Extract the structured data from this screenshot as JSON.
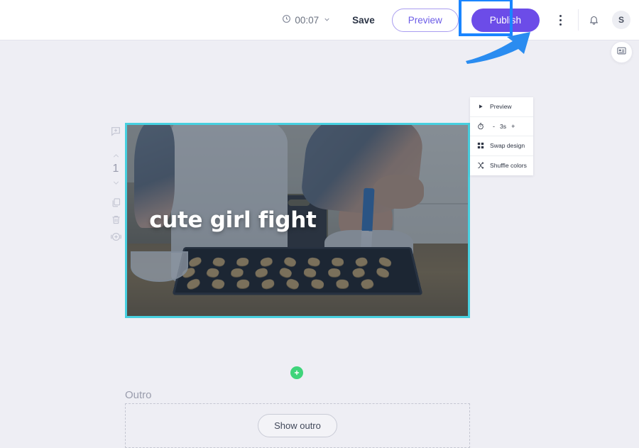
{
  "topbar": {
    "timer_value": "00:07",
    "timer_icon": "clock-icon",
    "timer_chevron_icon": "chevron-down-icon",
    "save_label": "Save",
    "preview_label": "Preview",
    "publish_label": "Publish",
    "more_icon": "kebab-menu-icon",
    "bell_icon": "notification-bell-icon",
    "avatar_initial": "S"
  },
  "annotation": {
    "highlight_color": "#1a85ff",
    "arrow_color": "#2a8cf0",
    "target": "publish-button"
  },
  "float_button": {
    "icon": "subtitle-card-icon"
  },
  "scene": {
    "number": "1",
    "tools": [
      {
        "name": "add-comment-icon",
        "label": "add-comment"
      },
      {
        "name": "move-up-icon",
        "label": "move-up"
      },
      {
        "name": "scene-number",
        "label": "1"
      },
      {
        "name": "move-down-icon",
        "label": "move-down"
      },
      {
        "name": "duplicate-scene-icon",
        "label": "duplicate"
      },
      {
        "name": "delete-scene-icon",
        "label": "delete"
      },
      {
        "name": "add-media-icon",
        "label": "add-media"
      }
    ],
    "title_text": "cute girl fight",
    "border_color": "#47d0e0"
  },
  "scene_panel": {
    "preview_label": "Preview",
    "preview_icon": "play-icon",
    "duration_icon": "stopwatch-icon",
    "duration_decrease": "-",
    "duration_value": "3s",
    "duration_increase": "+",
    "swap_design_label": "Swap design",
    "swap_design_icon": "grid-layout-icon",
    "shuffle_colors_label": "Shuffle colors",
    "shuffle_colors_icon": "shuffle-icon"
  },
  "add_scene": {
    "icon": "plus-icon",
    "color": "#3ed47a"
  },
  "outro": {
    "section_label": "Outro",
    "button_label": "Show outro"
  }
}
